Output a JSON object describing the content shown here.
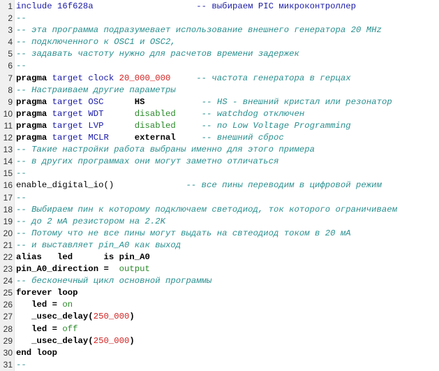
{
  "editor": {
    "lines": [
      {
        "n": "1",
        "tokens": [
          {
            "t": "include 16f628a",
            "c": "kw-include"
          },
          {
            "t": "                    -- выбираем PIC микроконтроллер",
            "c": "cmt-blue"
          }
        ]
      },
      {
        "n": "2",
        "tokens": [
          {
            "t": "--",
            "c": "cmt-plain"
          }
        ]
      },
      {
        "n": "3",
        "tokens": [
          {
            "t": "-- эта программа подразумевает использование внешнего генератора 20 MHz",
            "c": "cmt"
          }
        ]
      },
      {
        "n": "4",
        "tokens": [
          {
            "t": "-- подключенного к OSC1 и OSC2,",
            "c": "cmt"
          }
        ]
      },
      {
        "n": "5",
        "tokens": [
          {
            "t": "-- задавать частоту нужно для расчетов времени задержек",
            "c": "cmt"
          }
        ]
      },
      {
        "n": "6",
        "tokens": [
          {
            "t": "--",
            "c": "cmt-plain"
          }
        ]
      },
      {
        "n": "7",
        "tokens": [
          {
            "t": "pragma",
            "c": "kw-pragma"
          },
          {
            "t": " target clock ",
            "c": "kw-target"
          },
          {
            "t": "20_000_000",
            "c": "num"
          },
          {
            "t": "     -- частота генератора в герцах",
            "c": "cmt"
          }
        ]
      },
      {
        "n": "8",
        "tokens": [
          {
            "t": "-- Настраиваем другие параметры",
            "c": "cmt"
          }
        ]
      },
      {
        "n": "9",
        "tokens": [
          {
            "t": "pragma",
            "c": "kw-pragma"
          },
          {
            "t": " target OSC",
            "c": "kw-target"
          },
          {
            "t": "      HS",
            "c": "bold"
          },
          {
            "t": "           -- HS - внешний кристал или резонатор",
            "c": "cmt"
          }
        ]
      },
      {
        "n": "10",
        "tokens": [
          {
            "t": "pragma",
            "c": "kw-pragma"
          },
          {
            "t": " target WDT",
            "c": "kw-target"
          },
          {
            "t": "      disabled",
            "c": "const"
          },
          {
            "t": "     -- watchdog отключен",
            "c": "cmt"
          }
        ]
      },
      {
        "n": "11",
        "tokens": [
          {
            "t": "pragma",
            "c": "kw-pragma"
          },
          {
            "t": " target LVP",
            "c": "kw-target"
          },
          {
            "t": "      disabled",
            "c": "const"
          },
          {
            "t": "     -- no Low Voltage Programming",
            "c": "cmt"
          }
        ]
      },
      {
        "n": "12",
        "tokens": [
          {
            "t": "pragma",
            "c": "kw-pragma"
          },
          {
            "t": " target MCLR",
            "c": "kw-target"
          },
          {
            "t": "     external",
            "c": "bold"
          },
          {
            "t": "     -- внешний сброс",
            "c": "cmt"
          }
        ]
      },
      {
        "n": "13",
        "tokens": [
          {
            "t": "-- Такие настройки работа выбраны именно для этого примера",
            "c": "cmt"
          }
        ]
      },
      {
        "n": "14",
        "tokens": [
          {
            "t": "-- в других программах они могут заметно отличаться",
            "c": "cmt"
          }
        ]
      },
      {
        "n": "15",
        "tokens": [
          {
            "t": "--",
            "c": "cmt-plain"
          }
        ]
      },
      {
        "n": "16",
        "tokens": [
          {
            "t": "enable_digital_io()",
            "c": "plain"
          },
          {
            "t": "              -- все пины переводим в цифровой режим",
            "c": "cmt"
          }
        ]
      },
      {
        "n": "17",
        "tokens": [
          {
            "t": "--",
            "c": "cmt-plain"
          }
        ]
      },
      {
        "n": "18",
        "tokens": [
          {
            "t": "-- Выбираем пин к которому подключаем светодиод, ток которого ограничиваем",
            "c": "cmt"
          }
        ]
      },
      {
        "n": "19",
        "tokens": [
          {
            "t": "-- до 2 мА резистором на 2.2K",
            "c": "cmt"
          }
        ]
      },
      {
        "n": "20",
        "tokens": [
          {
            "t": "-- Потому что не все пины могут выдать на свтеодиод током в 20 мА",
            "c": "cmt"
          }
        ]
      },
      {
        "n": "21",
        "tokens": [
          {
            "t": "-- и выставляет pin_A0 как выход",
            "c": "cmt"
          }
        ]
      },
      {
        "n": "22",
        "tokens": [
          {
            "t": "alias   led      is pin_A0",
            "c": "bold"
          }
        ]
      },
      {
        "n": "23",
        "tokens": [
          {
            "t": "pin_A0_direction =  ",
            "c": "bold"
          },
          {
            "t": "output",
            "c": "const"
          }
        ]
      },
      {
        "n": "24",
        "tokens": [
          {
            "t": "-- бесконечный цикл основной программы",
            "c": "cmt"
          }
        ]
      },
      {
        "n": "25",
        "tokens": [
          {
            "t": "forever loop",
            "c": "bold"
          }
        ]
      },
      {
        "n": "26",
        "tokens": [
          {
            "t": "   led = ",
            "c": "bold"
          },
          {
            "t": "on",
            "c": "const"
          }
        ]
      },
      {
        "n": "27",
        "tokens": [
          {
            "t": "   _usec_delay(",
            "c": "bold"
          },
          {
            "t": "250_000",
            "c": "num"
          },
          {
            "t": ")",
            "c": "bold"
          }
        ]
      },
      {
        "n": "28",
        "tokens": [
          {
            "t": "   led = ",
            "c": "bold"
          },
          {
            "t": "off",
            "c": "const"
          }
        ]
      },
      {
        "n": "29",
        "tokens": [
          {
            "t": "   _usec_delay(",
            "c": "bold"
          },
          {
            "t": "250_000",
            "c": "num"
          },
          {
            "t": ")",
            "c": "bold"
          }
        ]
      },
      {
        "n": "30",
        "tokens": [
          {
            "t": "end loop",
            "c": "bold"
          }
        ]
      },
      {
        "n": "31",
        "tokens": [
          {
            "t": "--",
            "c": "cmt-plain"
          }
        ]
      }
    ]
  }
}
